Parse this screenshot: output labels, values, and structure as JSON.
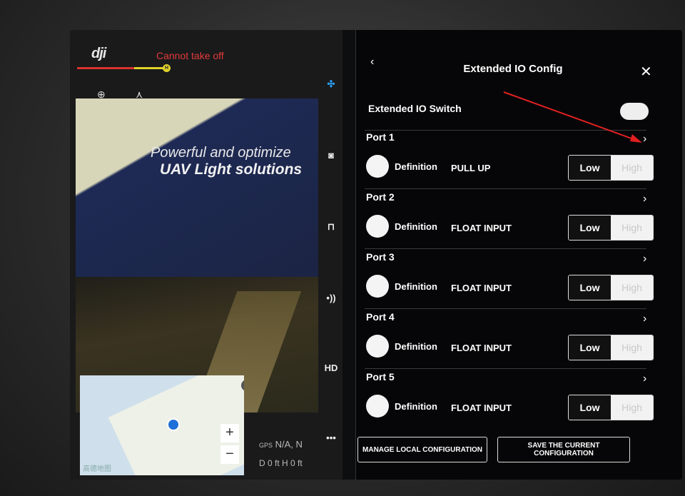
{
  "camera": {
    "logo": "dji",
    "status": "Cannot take off",
    "battery_marker": "H",
    "poster_line1": "Powerful and optimize",
    "poster_line2": "UAV Light solutions",
    "gps_label": "GPS",
    "gps_value": "N/A, N",
    "distance": "D 0 ft",
    "height": "H 0 ft",
    "map_label": "高德地图"
  },
  "toolbar": {
    "hd_label": "HD",
    "more_label": "•••"
  },
  "panel": {
    "back_icon": "‹",
    "title": "Extended IO Config",
    "close_icon": "✕",
    "switch_label": "Extended IO Switch",
    "switch_on": true,
    "definition_label": "Definition",
    "low_label": "Low",
    "high_label": "High",
    "ports": [
      {
        "name": "Port 1",
        "definition": "PULL UP",
        "level": "Low"
      },
      {
        "name": "Port 2",
        "definition": "FLOAT INPUT",
        "level": "Low"
      },
      {
        "name": "Port 3",
        "definition": "FLOAT INPUT",
        "level": "Low"
      },
      {
        "name": "Port 4",
        "definition": "FLOAT INPUT",
        "level": "Low"
      },
      {
        "name": "Port 5",
        "definition": "FLOAT INPUT",
        "level": "Low"
      }
    ],
    "manage_button": "MANAGE LOCAL CONFIGURATION",
    "save_button": "SAVE THE CURRENT CONFIGURATION"
  },
  "colors": {
    "warning": "#e23a3a",
    "accent": "#2aa3ff",
    "annotation_arrow": "#e02020"
  }
}
